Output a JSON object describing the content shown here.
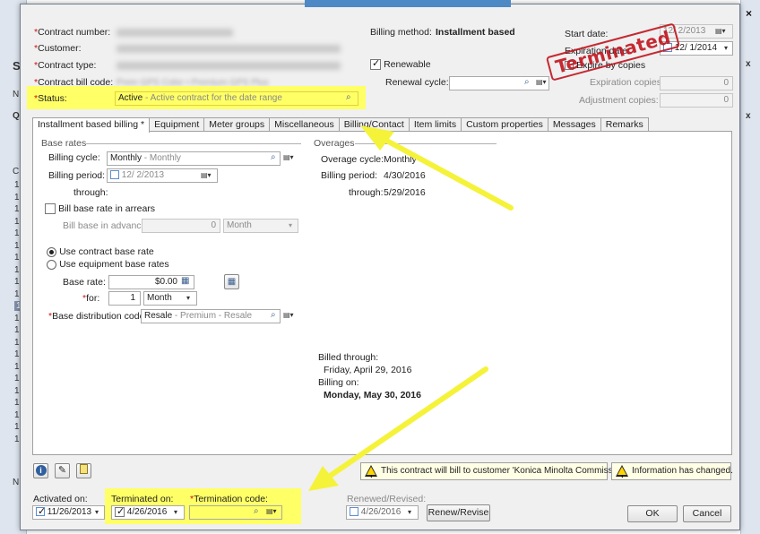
{
  "colors": {
    "highlight": "#ffff66",
    "required": "#d01010",
    "arrow": "#f5f23a",
    "stamp": "#c1141e"
  },
  "header": {
    "contract_number_label": "*Contract number:",
    "customer_label": "*Customer:",
    "contract_type_label": "*Contract type:",
    "contract_bill_code_label": "*Contract bill code:",
    "contract_bill_code_value": "Prem GPS Color • Premium GPS Plus",
    "status_label": "*Status:",
    "status_value": "Active",
    "status_desc": " - Active contract for the date range",
    "billing_method_label": "Billing method:",
    "billing_method_value": "Installment based",
    "renewable_label": "Renewable",
    "renewal_cycle_label": "Renewal cycle:",
    "start_date_label": "Start date:",
    "start_date_value": "12/ 2/2013",
    "expiration_date_label": "Expiration date:",
    "expiration_date_value": "12/ 1/2014",
    "expire_by_copies_label": "Expire by copies",
    "expiration_copies_label": "Expiration copies:",
    "expiration_copies_value": "0",
    "adjustment_copies_label": "Adjustment copies:",
    "adjustment_copies_value": "0",
    "stamp_text": "Terminated"
  },
  "tabs": [
    {
      "label": "Installment based billing *"
    },
    {
      "label": "Equipment"
    },
    {
      "label": "Meter groups"
    },
    {
      "label": "Miscellaneous"
    },
    {
      "label": "Billing/Contact"
    },
    {
      "label": "Item limits"
    },
    {
      "label": "Custom properties"
    },
    {
      "label": "Messages"
    },
    {
      "label": "Remarks"
    }
  ],
  "base_rates": {
    "section_title": "Base rates",
    "billing_cycle_label": "Billing cycle:",
    "billing_cycle_value": "Monthly",
    "billing_cycle_desc": " - Monthly",
    "billing_period_label": "Billing period:",
    "billing_period_value": "12/ 2/2013",
    "through_label": "through:",
    "arrears_label": "Bill base rate in arrears",
    "advance_label": "Bill base in advance:",
    "advance_value": "0",
    "advance_unit": "Month",
    "use_contract_rate_label": "Use contract base rate",
    "use_equipment_rate_label": "Use equipment base rates",
    "base_rate_label": "Base rate:",
    "base_rate_value": "$0.00",
    "for_label": "*for:",
    "for_value": "1",
    "for_unit": "Month",
    "distribution_label": "*Base distribution code:",
    "distribution_value": "Resale",
    "distribution_desc": " - Premium - Resale"
  },
  "overages": {
    "section_title": "Overages",
    "cycle_label": "Overage cycle:",
    "cycle_value": "Monthly",
    "period_label": "Billing period:",
    "period_value": "4/30/2016",
    "through_label": "through:",
    "through_value": "5/29/2016"
  },
  "billing_summary": {
    "billed_through_label": "Billed through:",
    "billed_through_value": "Friday, April 29, 2016",
    "billing_on_label": "Billing on:",
    "billing_on_value": "Monday, May 30, 2016"
  },
  "status_bar": {
    "warning_bill_to": "This contract will bill to customer 'Konica Minolta Commissions'.",
    "warning_changed": "Information has changed."
  },
  "footer": {
    "activated_label": "Activated on:",
    "activated_value": "11/26/2013",
    "terminated_label": "Terminated on:",
    "terminated_value": "4/26/2016",
    "termination_code_label": "*Termination code:",
    "renewed_label": "Renewed/Revised:",
    "renewed_value": "4/26/2016",
    "renew_button": "Renew/Revise",
    "ok_button": "OK",
    "cancel_button": "Cancel"
  },
  "background": {
    "left_letters": [
      "S",
      "N",
      "Q",
      "C",
      "N"
    ],
    "right_letters": [
      "x",
      "x"
    ]
  }
}
